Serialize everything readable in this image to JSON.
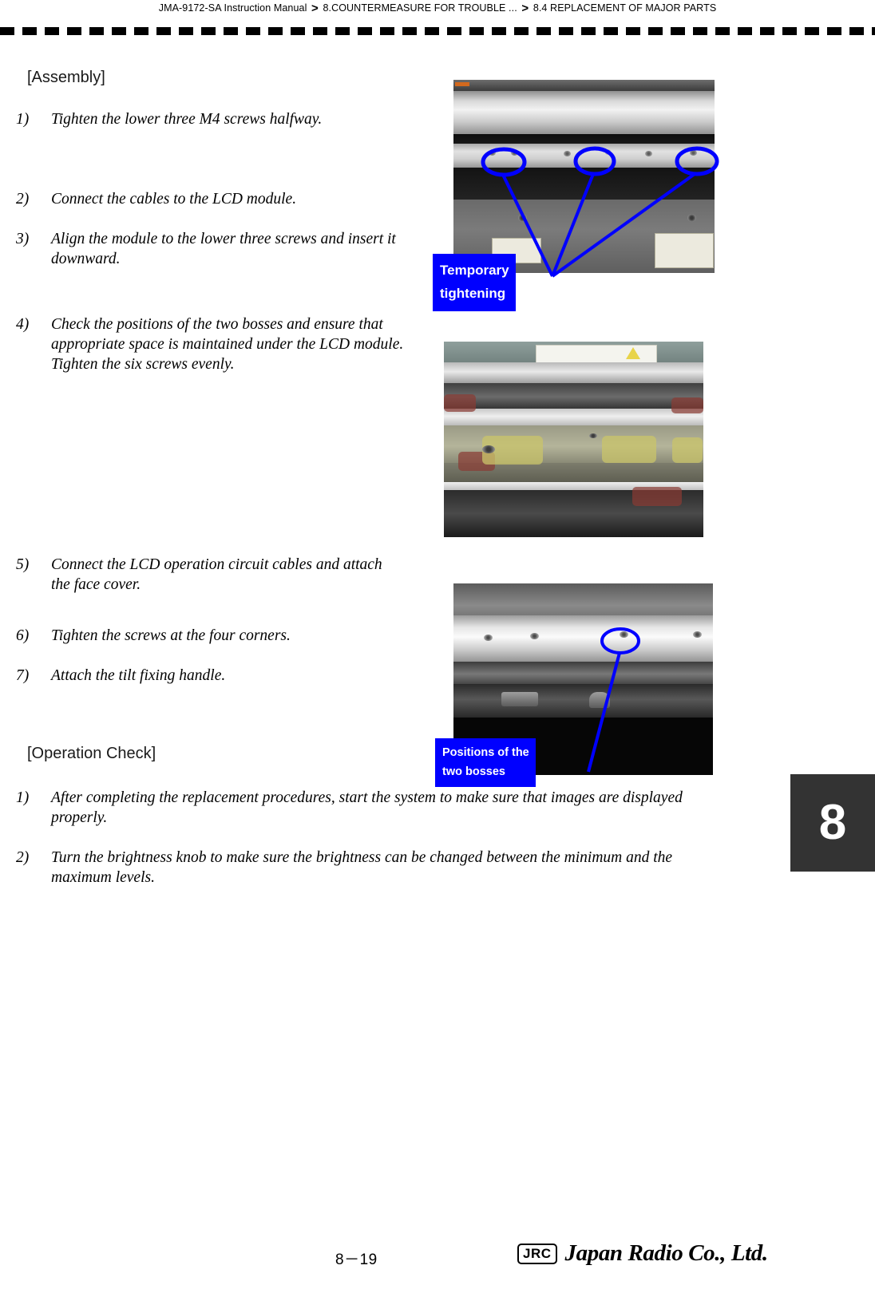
{
  "header": {
    "breadcrumb": [
      {
        "label": "JMA-9172-SA Instruction Manual"
      },
      {
        "label": "8.COUNTERMEASURE FOR TROUBLE ..."
      },
      {
        "label": "8.4  REPLACEMENT OF MAJOR PARTS"
      }
    ],
    "separator": ">"
  },
  "content": {
    "assembly_heading": "[Assembly]",
    "assembly_steps": [
      {
        "num": "1)",
        "text": "Tighten the lower three M4 screws halfway."
      },
      {
        "num": "2)",
        "text": "Connect the cables to the LCD module."
      },
      {
        "num": "3)",
        "text": "Align the module to the lower three screws and insert it downward."
      },
      {
        "num": "4)",
        "text": "Check the positions of the two bosses and ensure that appropriate space is maintained under the LCD module. Tighten the six screws evenly."
      },
      {
        "num": "5)",
        "text": "Connect the LCD operation circuit cables and attach the face cover."
      },
      {
        "num": "6)",
        "text": "Tighten the screws at the four corners."
      },
      {
        "num": "7)",
        "text": "Attach the tilt fixing handle."
      }
    ],
    "operation_heading": "[Operation Check]",
    "operation_steps": [
      {
        "num": "1)",
        "text": "After completing the replacement procedures, start the system to make sure that images are displayed properly."
      },
      {
        "num": "2)",
        "text": "Turn the brightness knob to make sure the brightness can be changed between the minimum and the maximum levels."
      }
    ]
  },
  "callouts": {
    "temporary_tightening": "Temporary\ntightening",
    "temporary_tightening_line1": "Temporary",
    "temporary_tightening_line2": "tightening",
    "positions_line1": "Positions of the",
    "positions_line2": "two bosses"
  },
  "chapter_tab": {
    "number": "8"
  },
  "footer": {
    "page_number": "8－19",
    "logo_mark": "JRC",
    "company": "Japan Radio Co., Ltd."
  },
  "colors": {
    "callout_blue": "#0000FF",
    "callout_text": "#FFFFFF",
    "chapter_tab_bg": "#333333",
    "page_bg": "#FFFFFF",
    "text": "#000000"
  }
}
